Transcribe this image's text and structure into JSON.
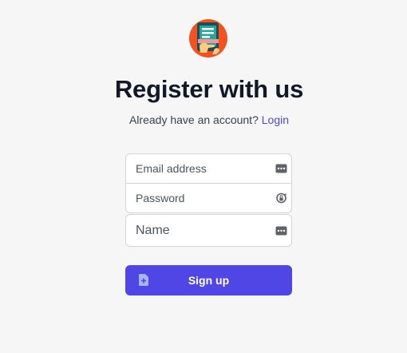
{
  "header": {
    "logo_icon": "tablet-hand-logo-icon",
    "title": "Register with us",
    "subtitle_text": "Already have an account?",
    "login_link": "Login"
  },
  "form": {
    "email": {
      "placeholder": "Email address",
      "value": "",
      "icon": "password-manager-icon"
    },
    "password": {
      "placeholder": "Password",
      "value": "",
      "icon": "password-reveal-icon"
    },
    "name": {
      "placeholder": "Name",
      "value": "",
      "icon": "password-manager-icon"
    }
  },
  "signup_button": {
    "label": "Sign up",
    "icon": "document-plus-icon"
  },
  "colors": {
    "background": "#f6f6f6",
    "accent": "#4f46e5",
    "title": "#111827",
    "logo_orange": "#f4511e",
    "logo_teal": "#26a69a"
  }
}
